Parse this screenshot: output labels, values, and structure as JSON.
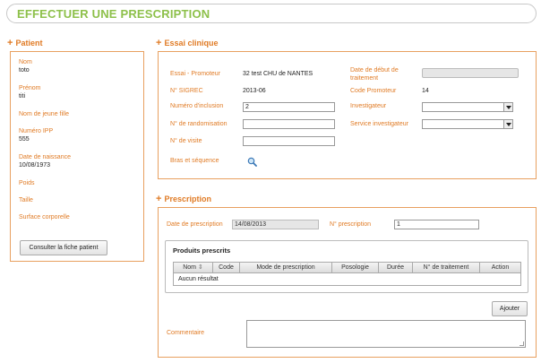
{
  "page": {
    "title": "EFFECTUER UNE PRESCRIPTION"
  },
  "patient": {
    "heading": "Patient",
    "fields": [
      {
        "label": "Nom",
        "value": "toto"
      },
      {
        "label": "Prénom",
        "value": "titi"
      },
      {
        "label": "Nom de jeune fille",
        "value": ""
      },
      {
        "label": "Numéro IPP",
        "value": "555"
      },
      {
        "label": "Date de naissance",
        "value": "10/08/1973"
      },
      {
        "label": "Poids",
        "value": ""
      },
      {
        "label": "Taille",
        "value": ""
      },
      {
        "label": "Surface corporelle",
        "value": ""
      }
    ],
    "button": "Consulter la fiche patient"
  },
  "essai": {
    "heading": "Essai clinique",
    "promoteur_label": "Essai - Promoteur",
    "promoteur_value": "32 test CHU de NANTES",
    "date_debut_label": "Date de début de traitement",
    "date_debut_value": "",
    "sigrec_label": "N° SIGREC",
    "sigrec_value": "2013-06",
    "code_promoteur_label": "Code Promoteur",
    "code_promoteur_value": "14",
    "inclusion_label": "Numéro d'inclusion",
    "inclusion_value": "2",
    "investigateur_label": "Investigateur",
    "investigateur_value": "",
    "randomisation_label": "N° de randomisation",
    "randomisation_value": "",
    "service_label": "Service investigateur",
    "service_value": "",
    "visite_label": "N° de visite",
    "visite_value": "",
    "bras_label": "Bras et séquence"
  },
  "prescription": {
    "heading": "Prescription",
    "date_label": "Date de prescription",
    "date_value": "14/08/2013",
    "numero_label": "N° prescription",
    "numero_value": "1",
    "produits_title": "Produits prescrits",
    "columns": [
      "Nom",
      "Code",
      "Mode de prescription",
      "Posologie",
      "Durée",
      "N° de traitement",
      "Action"
    ],
    "empty_text": "Aucun résultat",
    "add_button": "Ajouter",
    "commentaire_label": "Commentaire",
    "commentaire_value": ""
  },
  "colors": {
    "accent": "#e07b25",
    "title_green": "#8dc04a",
    "panel_border": "#e8a060"
  },
  "icons": {
    "search": "magnifier-icon",
    "sort": "sort-icon"
  }
}
